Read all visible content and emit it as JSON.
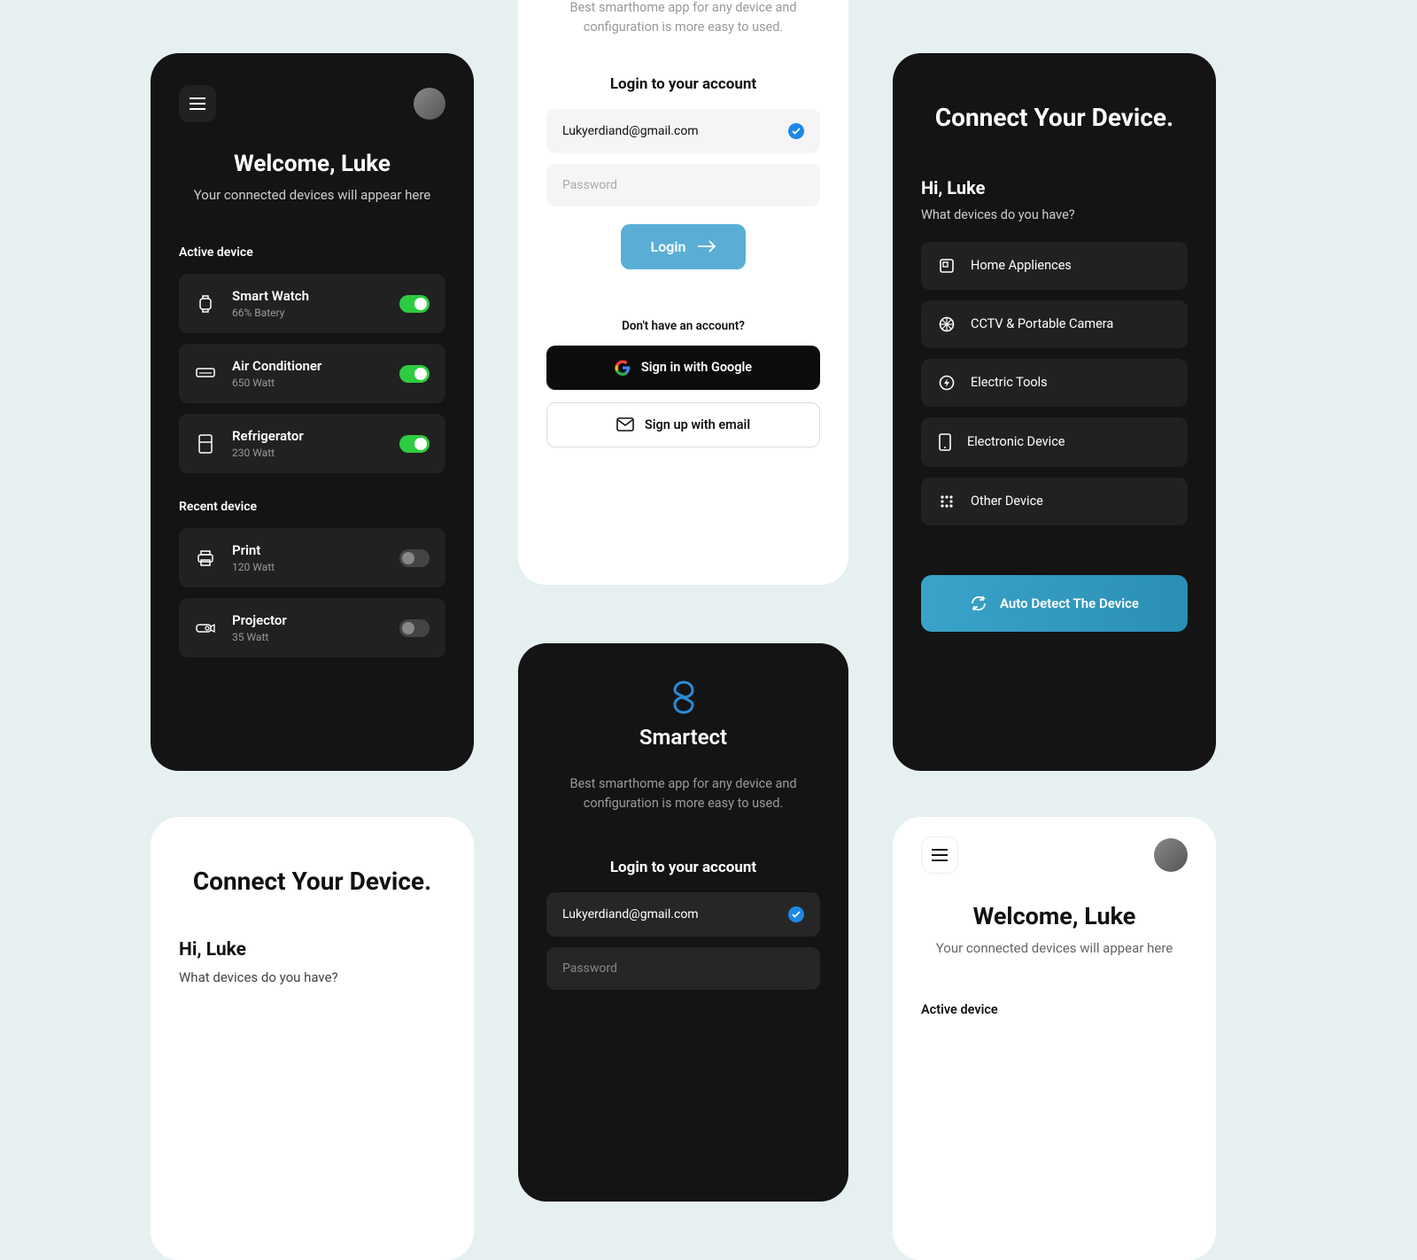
{
  "welcome": {
    "title": "Welcome, Luke",
    "subtitle": "Your connected devices will appear here",
    "active_label": "Active device",
    "recent_label": "Recent device",
    "devices_active": [
      {
        "name": "Smart Watch",
        "sub": "66% Batery",
        "on": true
      },
      {
        "name": "Air Conditioner",
        "sub": "650 Watt",
        "on": true
      },
      {
        "name": "Refrigerator",
        "sub": "230 Watt",
        "on": true
      }
    ],
    "devices_recent": [
      {
        "name": "Print",
        "sub": "120 Watt",
        "on": false
      },
      {
        "name": "Projector",
        "sub": "35 Watt",
        "on": false
      }
    ]
  },
  "login": {
    "brand": "Smartect",
    "tagline": "Best smarthome app for any device and configuration is more easy to used.",
    "title": "Login to your account",
    "email": "Lukyerdiand@gmail.com",
    "password_placeholder": "Password",
    "login_button": "Login",
    "no_account": "Don't have an account?",
    "google": "Sign in with Google",
    "email_signup": "Sign up with email"
  },
  "connect": {
    "title": "Connect Your Device.",
    "hi": "Hi, Luke",
    "q": "What devices do you have?",
    "categories": [
      "Home Appliences",
      "CCTV & Portable Camera",
      "Electric Tools",
      "Electronic Device",
      "Other Device"
    ],
    "auto": "Auto Detect The Device"
  }
}
